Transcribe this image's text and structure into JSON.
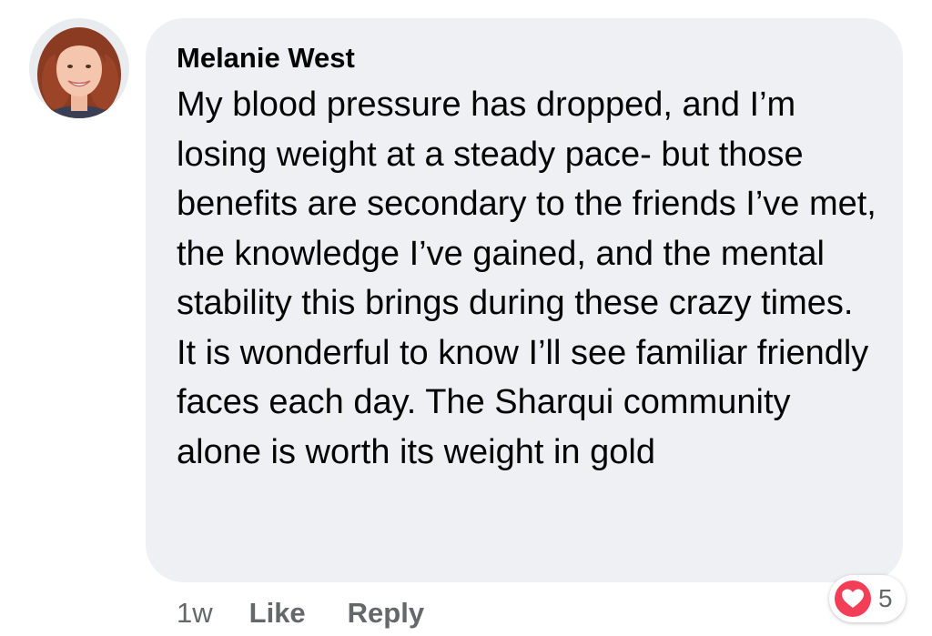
{
  "comment": {
    "author": "Melanie West",
    "text": "My blood pressure has dropped, and I’m losing weight at a steady pace- but those benefits are secondary to the friends I’ve met, the knowledge I’ve gained, and the mental stability this brings during these crazy times. It is wonderful to know I’ll see familiar friendly faces each day. The Sharqui community alone is worth its weight in gold",
    "timestamp": "1w",
    "like_label": "Like",
    "reply_label": "Reply",
    "reaction": {
      "icon": "heart-icon",
      "count": "5",
      "color": "#f33e58"
    }
  },
  "colors": {
    "bubble": "#eff0f4",
    "text": "#050505",
    "meta": "#65676b"
  }
}
